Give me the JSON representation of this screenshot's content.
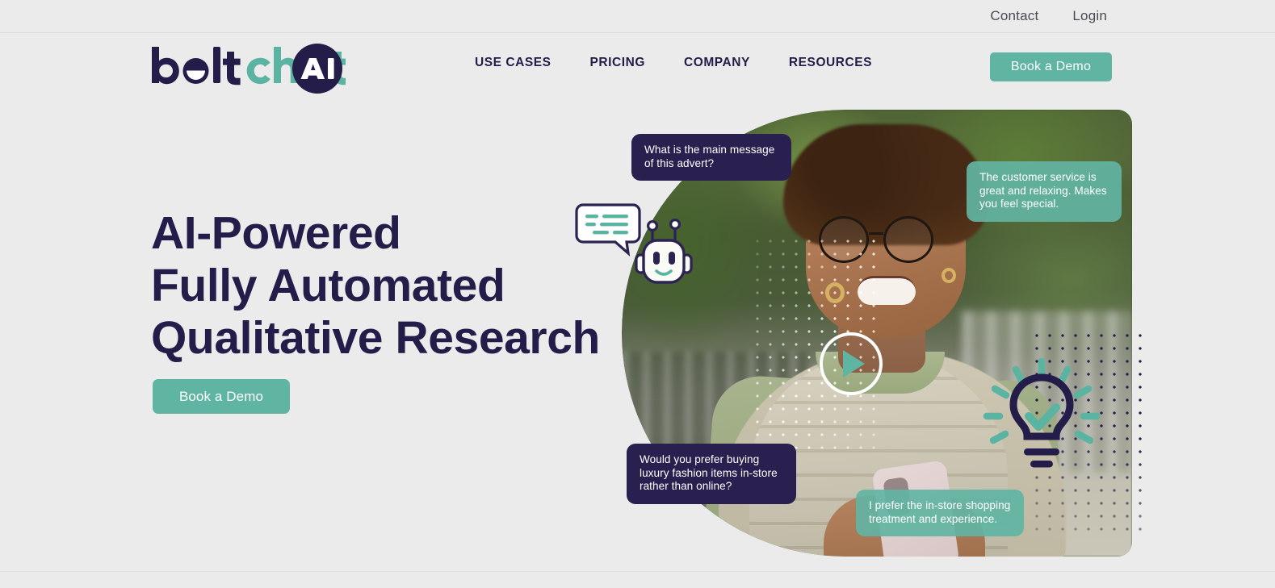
{
  "brand": {
    "logo_text_part1": "bolt",
    "logo_text_part2": "chat",
    "logo_badge": "AI",
    "navy": "#241c49",
    "teal": "#5fb4a2",
    "page_background": "#ebebeb"
  },
  "topbar": {
    "links": [
      {
        "label": "Contact",
        "name": "contact"
      },
      {
        "label": "Login",
        "name": "login"
      }
    ]
  },
  "header": {
    "nav": [
      {
        "label": "USE CASES"
      },
      {
        "label": "PRICING"
      },
      {
        "label": "COMPANY"
      },
      {
        "label": "RESOURCES"
      }
    ],
    "cta_label": "Book a Demo"
  },
  "hero": {
    "title_line1": "AI-Powered",
    "title_line2": "Fully Automated",
    "title_line3": "Qualitative Research",
    "title_full": "AI-Powered\nFully Automated\nQualitative Research",
    "cta_label": "Book a Demo"
  },
  "visual": {
    "bubbles": [
      {
        "id": "bubble-question-advert",
        "kind": "question",
        "text": "What is the main message of this advert?"
      },
      {
        "id": "bubble-answer-service",
        "kind": "answer",
        "text": "The customer service is great and relaxing. Makes you feel special."
      },
      {
        "id": "bubble-question-luxury",
        "kind": "question",
        "text": "Would you prefer buying luxury fashion items in-store rather than online?"
      },
      {
        "id": "bubble-answer-instore",
        "kind": "answer",
        "text": "I prefer the in-store shopping treatment and experience."
      }
    ],
    "icons": [
      {
        "name": "robot-icon",
        "meaning": "chatbot robot head with speech bubble"
      },
      {
        "name": "play-icon",
        "meaning": "video play button"
      },
      {
        "name": "lightbulb-check-icon",
        "meaning": "lightbulb with teal checkmark and rays"
      }
    ],
    "photo_alt": "Smiling woman with glasses holding a smartphone outdoors"
  }
}
